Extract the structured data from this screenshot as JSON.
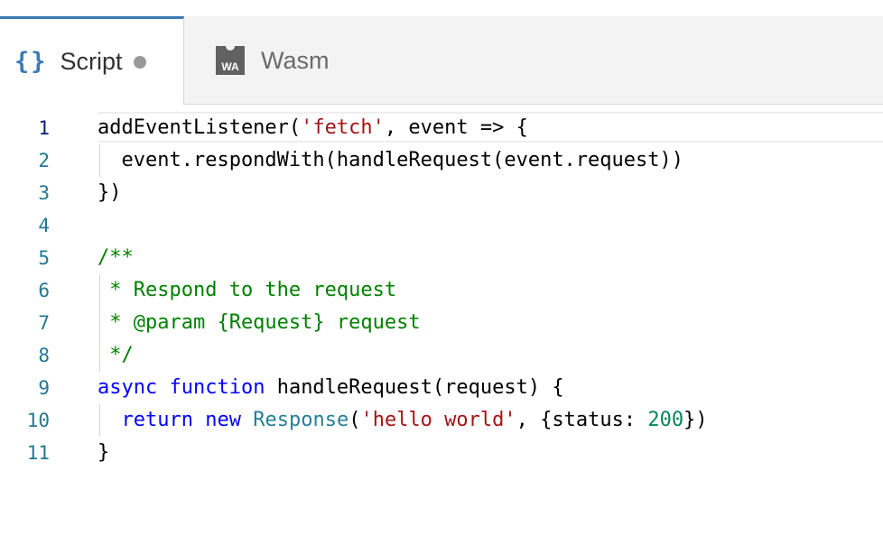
{
  "tabs": [
    {
      "label": "Script",
      "icon": "braces-icon",
      "icon_glyph": "{}",
      "active": true,
      "modified": true
    },
    {
      "label": "Wasm",
      "icon": "wasm-icon",
      "icon_text": "WA",
      "active": false
    }
  ],
  "colors": {
    "accent": "#3a7ab5",
    "string": "#a31515",
    "keyword": "#0000ff",
    "type": "#267f99",
    "number": "#098658",
    "comment": "#008000",
    "line_number": "#237893"
  },
  "editor": {
    "active_line": 1,
    "lines": [
      {
        "n": "1",
        "t": [
          [
            "p",
            "addEventListener("
          ],
          [
            "s",
            "'fetch'"
          ],
          [
            "p",
            ", event => {"
          ]
        ]
      },
      {
        "n": "2",
        "t": [
          [
            "p",
            "  event.respondWith(handleRequest(event.request))"
          ]
        ]
      },
      {
        "n": "3",
        "t": [
          [
            "p",
            "})"
          ]
        ]
      },
      {
        "n": "4",
        "t": []
      },
      {
        "n": "5",
        "t": [
          [
            "c",
            "/**"
          ]
        ]
      },
      {
        "n": "6",
        "t": [
          [
            "c",
            " * Respond to the request"
          ]
        ]
      },
      {
        "n": "7",
        "t": [
          [
            "c",
            " * @param {Request} request"
          ]
        ]
      },
      {
        "n": "8",
        "t": [
          [
            "c",
            " */"
          ]
        ]
      },
      {
        "n": "9",
        "t": [
          [
            "k",
            "async"
          ],
          [
            "p",
            " "
          ],
          [
            "k",
            "function"
          ],
          [
            "p",
            " handleRequest(request) {"
          ]
        ]
      },
      {
        "n": "10",
        "t": [
          [
            "p",
            "  "
          ],
          [
            "k",
            "return"
          ],
          [
            "p",
            " "
          ],
          [
            "k",
            "new"
          ],
          [
            "p",
            " "
          ],
          [
            "y",
            "Response"
          ],
          [
            "p",
            "("
          ],
          [
            "s",
            "'hello world'"
          ],
          [
            "p",
            ", {status: "
          ],
          [
            "d",
            "200"
          ],
          [
            "p",
            "})"
          ]
        ]
      },
      {
        "n": "11",
        "t": [
          [
            "p",
            "}"
          ]
        ]
      }
    ]
  }
}
